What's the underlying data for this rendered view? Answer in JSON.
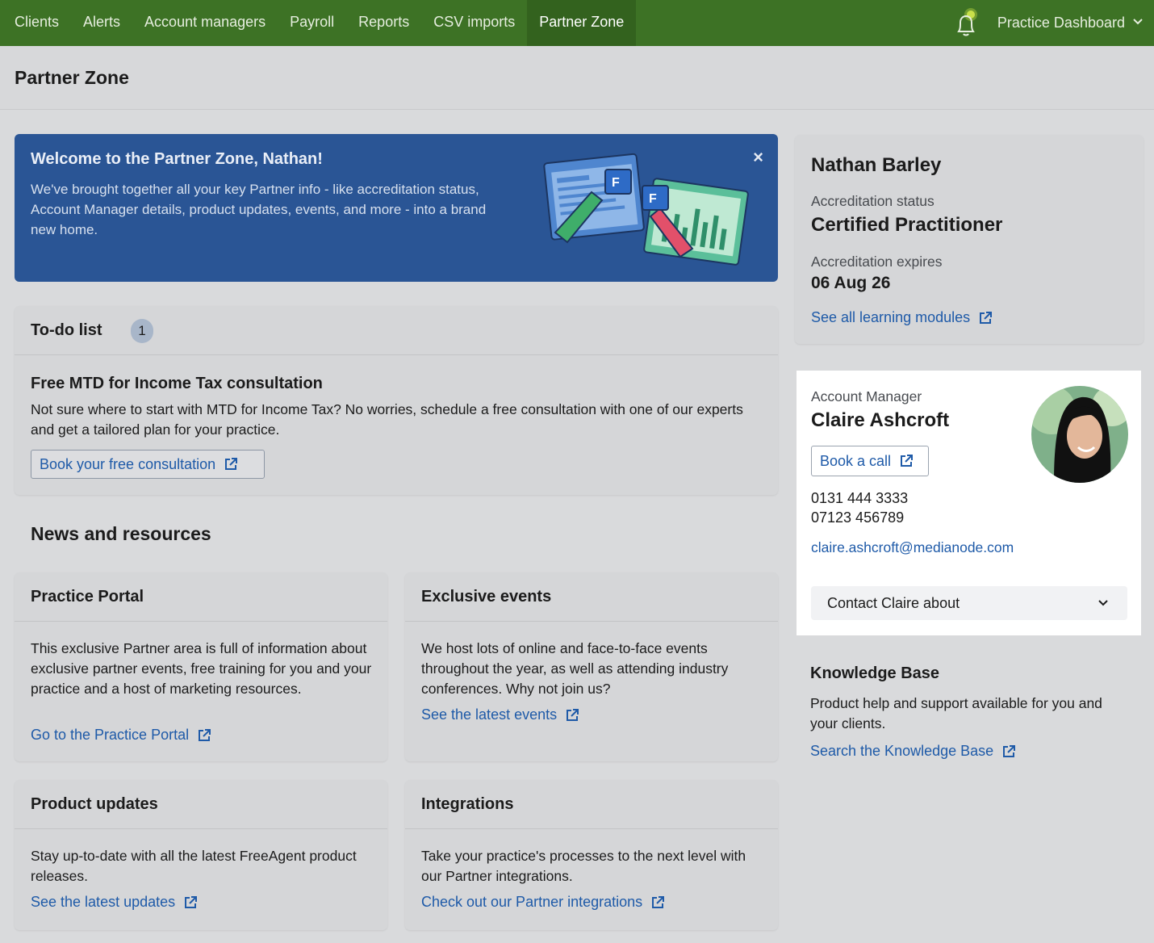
{
  "nav": {
    "items": [
      {
        "label": "Clients"
      },
      {
        "label": "Alerts"
      },
      {
        "label": "Account managers"
      },
      {
        "label": "Payroll"
      },
      {
        "label": "Reports"
      },
      {
        "label": "CSV imports"
      },
      {
        "label": "Partner Zone"
      }
    ],
    "active": "Partner Zone",
    "dashboard_label": "Practice Dashboard"
  },
  "page": {
    "title": "Partner Zone"
  },
  "welcome": {
    "title": "Welcome to the Partner Zone, Nathan!",
    "text": "We've brought together all your key Partner info - like accreditation status, Account Manager details, product updates, events, and more - into a brand new home.",
    "close": "×"
  },
  "todo": {
    "title": "To-do list",
    "count": "1",
    "item_title": "Free MTD for Income Tax consultation",
    "item_text": "Not sure where to start with MTD for Income Tax? No worries, schedule a free consultation with one of our experts and get a tailored plan for your practice.",
    "button": "Book your free consultation"
  },
  "news": {
    "title": "News and resources",
    "tiles": [
      {
        "title": "Practice Portal",
        "text": "This exclusive Partner area is full of information about exclusive partner events, free training for you and your practice and a host of marketing resources.",
        "link": "Go to the Practice Portal"
      },
      {
        "title": "Exclusive events",
        "text": "We host lots of online and face-to-face events throughout the year, as well as attending industry conferences. Why not join us?",
        "link": "See the latest events"
      },
      {
        "title": "Product updates",
        "text": "Stay up-to-date with all the latest FreeAgent product releases.",
        "link": "See the latest updates"
      },
      {
        "title": "Integrations",
        "text": "Take your practice's processes to the next level with our Partner integrations.",
        "link": "Check out our Partner integrations"
      }
    ]
  },
  "profile": {
    "name": "Nathan Barley",
    "status_label": "Accreditation status",
    "status_value": "Certified Practitioner",
    "expires_label": "Accreditation expires",
    "expires_value": "06 Aug 26",
    "link": "See all learning modules"
  },
  "account_manager": {
    "label": "Account Manager",
    "name": "Claire Ashcroft",
    "button": "Book a call",
    "phone1": "0131 444 3333",
    "phone2": "07123 456789",
    "email": "claire.ashcroft@medianode.com",
    "select_label": "Contact Claire about"
  },
  "knowledge_base": {
    "title": "Knowledge Base",
    "text": "Product help and support available for you and your clients.",
    "link": "Search the Knowledge Base"
  },
  "colors": {
    "nav_bg": "#3d7225",
    "banner_bg": "#2a5595",
    "link": "#1e5aa8"
  }
}
